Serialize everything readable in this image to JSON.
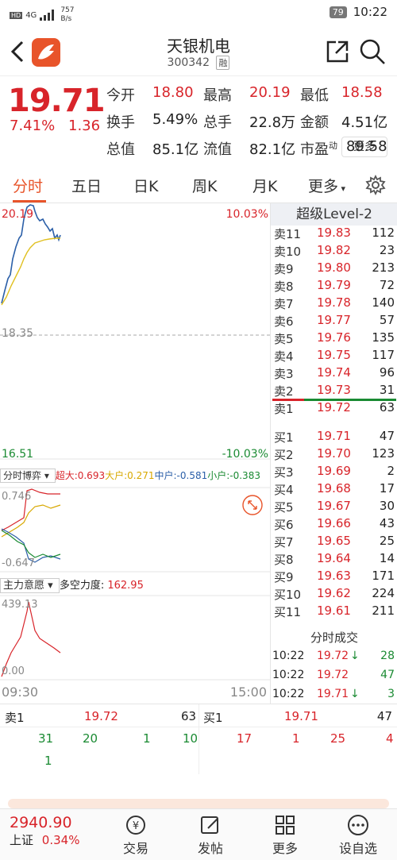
{
  "status_bar": {
    "network": "4G",
    "speed": "757\nB/s",
    "battery": "79",
    "time": "10:22"
  },
  "header": {
    "name": "天银机电",
    "code": "300342",
    "tag": "融"
  },
  "quote": {
    "price": "19.71",
    "change_pct": "7.41%",
    "change": "1.36",
    "rows": [
      [
        {
          "l": "今开",
          "v": "18.80",
          "c": "red"
        },
        {
          "l": "最高",
          "v": "20.19",
          "c": "red"
        },
        {
          "l": "最低",
          "v": "18.58",
          "c": "red"
        }
      ],
      [
        {
          "l": "换手",
          "v": "5.49%",
          "c": "dark"
        },
        {
          "l": "总手",
          "v": "22.8万",
          "c": "dark"
        },
        {
          "l": "金额",
          "v": "4.51亿",
          "c": "dark"
        }
      ],
      [
        {
          "l": "总值",
          "v": "85.1亿",
          "c": "dark"
        },
        {
          "l": "流值",
          "v": "82.1亿",
          "c": "dark"
        },
        {
          "l": "市盈",
          "sup": "动",
          "v": "89.58",
          "c": "dark"
        }
      ]
    ],
    "more_label": "更多"
  },
  "tabs": [
    "分时",
    "五日",
    "日K",
    "周K",
    "月K",
    "更多"
  ],
  "chart": {
    "high_price": "20.19",
    "high_pct": "10.03%",
    "mid_price": "18.35",
    "low_price": "16.51",
    "low_pct": "-10.03%",
    "boyi_label": "分时博弈",
    "boyi_items": [
      {
        "label": "超大:0.693",
        "color": "#d8242a"
      },
      {
        "label": "大户:0.271",
        "color": "#d8a800"
      },
      {
        "label": "中户:-0.581",
        "color": "#2b5fa8"
      },
      {
        "label": "小户:-0.383",
        "color": "#1a8a32"
      }
    ],
    "boyi_top": "0.746",
    "boyi_bottom": "-0.647",
    "main_label": "主力意愿",
    "force_label": "多空力度:",
    "force_value": "162.95",
    "main_top": "439.13",
    "main_bottom": "0.00",
    "time_start": "09:30",
    "time_end": "15:00"
  },
  "orderbook": {
    "title": "超级Level-2",
    "asks": [
      {
        "l": "卖11",
        "p": "19.83",
        "v": "112"
      },
      {
        "l": "卖10",
        "p": "19.82",
        "v": "23"
      },
      {
        "l": "卖9",
        "p": "19.80",
        "v": "213"
      },
      {
        "l": "卖8",
        "p": "19.79",
        "v": "72"
      },
      {
        "l": "卖7",
        "p": "19.78",
        "v": "140"
      },
      {
        "l": "卖6",
        "p": "19.77",
        "v": "57"
      },
      {
        "l": "卖5",
        "p": "19.76",
        "v": "135"
      },
      {
        "l": "卖4",
        "p": "19.75",
        "v": "117"
      },
      {
        "l": "卖3",
        "p": "19.74",
        "v": "96"
      },
      {
        "l": "卖2",
        "p": "19.73",
        "v": "31"
      },
      {
        "l": "卖1",
        "p": "19.72",
        "v": "63"
      }
    ],
    "bids": [
      {
        "l": "买1",
        "p": "19.71",
        "v": "47"
      },
      {
        "l": "买2",
        "p": "19.70",
        "v": "123"
      },
      {
        "l": "买3",
        "p": "19.69",
        "v": "2"
      },
      {
        "l": "买4",
        "p": "19.68",
        "v": "17"
      },
      {
        "l": "买5",
        "p": "19.67",
        "v": "30"
      },
      {
        "l": "买6",
        "p": "19.66",
        "v": "43"
      },
      {
        "l": "买7",
        "p": "19.65",
        "v": "25"
      },
      {
        "l": "买8",
        "p": "19.64",
        "v": "14"
      },
      {
        "l": "买9",
        "p": "19.63",
        "v": "171"
      },
      {
        "l": "买10",
        "p": "19.62",
        "v": "224"
      },
      {
        "l": "买11",
        "p": "19.61",
        "v": "211"
      }
    ],
    "trades_title": "分时成交",
    "trades": [
      {
        "t": "10:22",
        "p": "19.72",
        "arrow": "↓",
        "v": "28",
        "vc": "green"
      },
      {
        "t": "10:22",
        "p": "19.72",
        "arrow": "",
        "v": "47",
        "vc": "green"
      },
      {
        "t": "10:22",
        "p": "19.71",
        "arrow": "↓",
        "v": "3",
        "vc": "green"
      }
    ]
  },
  "summary": {
    "sell1_label": "卖1",
    "sell1_price": "19.72",
    "sell1_vol": "63",
    "buy1_label": "买1",
    "buy1_price": "19.71",
    "buy1_vol": "47",
    "sell_queue": [
      "31",
      "20",
      "1",
      "10",
      "1"
    ],
    "buy_queue": [
      "17",
      "1",
      "25",
      "4"
    ]
  },
  "bottom": {
    "index_value": "2940.90",
    "index_name": "上证",
    "index_pct": "0.34%",
    "nav": [
      "交易",
      "发帖",
      "更多",
      "设自选"
    ]
  },
  "colors": {
    "up": "#d8242a",
    "down": "#1a8a32",
    "accent": "#e8542a"
  }
}
